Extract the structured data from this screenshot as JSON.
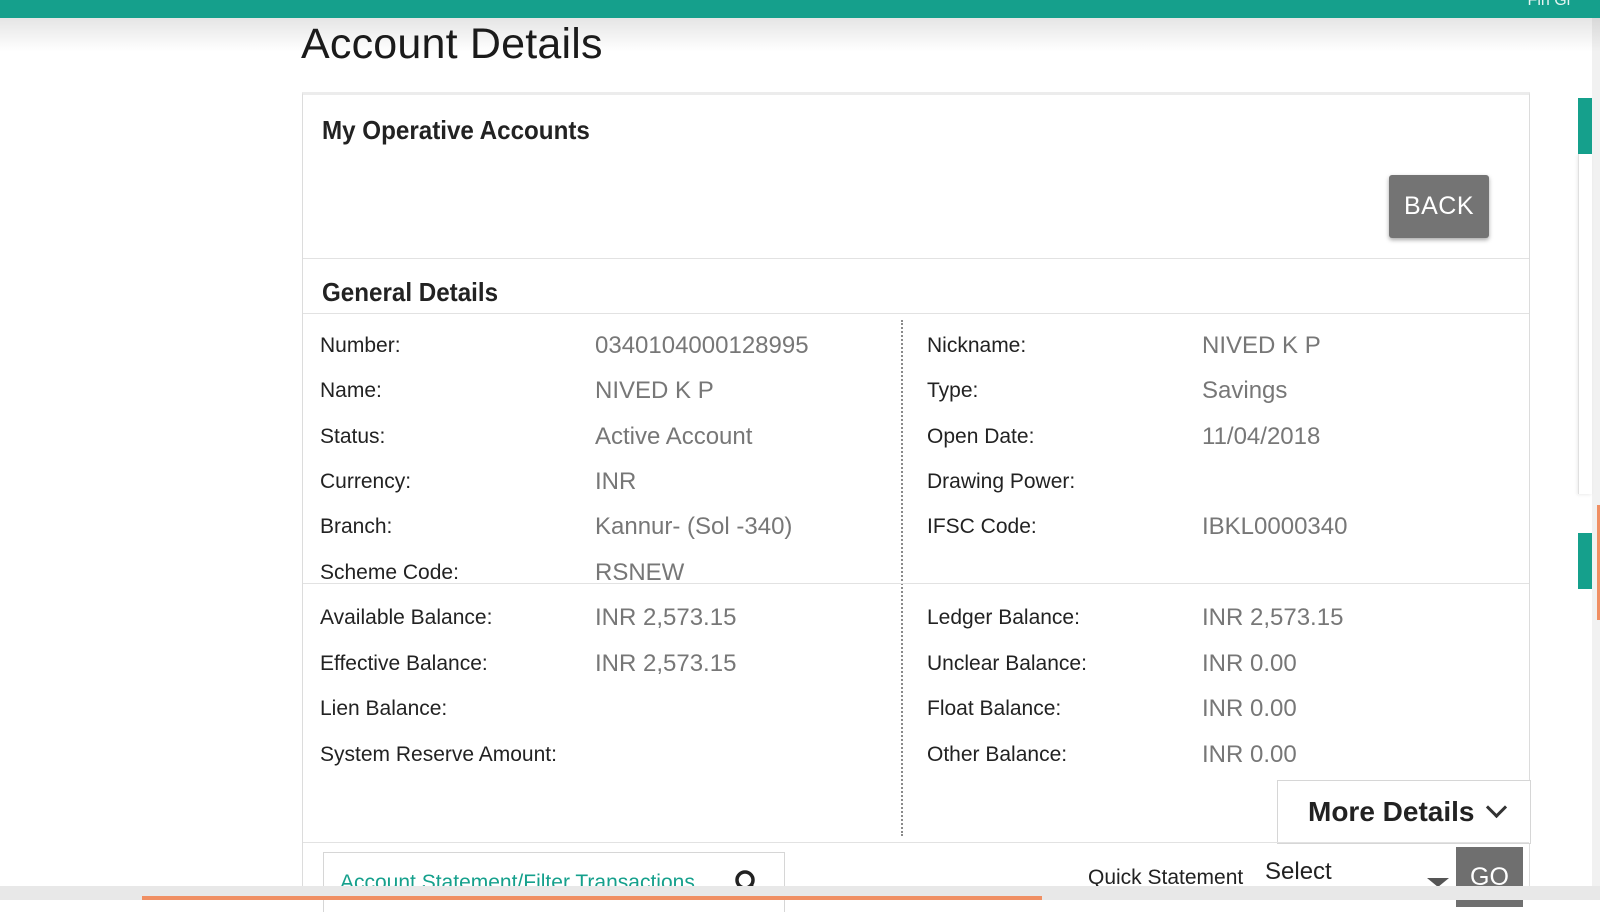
{
  "page": {
    "title": "Account Details",
    "topbar_text": "Fin Gr"
  },
  "operative": {
    "title": "My Operative Accounts",
    "back_label": "BACK"
  },
  "general": {
    "title": "General Details",
    "left_top": [
      {
        "label": "Number:",
        "value": "0340104000128995"
      },
      {
        "label": "Name:",
        "value": "NIVED K P"
      },
      {
        "label": "Status:",
        "value": "Active Account"
      },
      {
        "label": "Currency:",
        "value": "INR"
      },
      {
        "label": "Branch:",
        "value": "Kannur- (Sol -340)"
      },
      {
        "label": "Scheme Code:",
        "value": "RSNEW"
      }
    ],
    "right_top": [
      {
        "label": "Nickname:",
        "value": "NIVED K P"
      },
      {
        "label": "Type:",
        "value": "Savings"
      },
      {
        "label": "Open Date:",
        "value": "11/04/2018"
      },
      {
        "label": "Drawing Power:",
        "value": ""
      },
      {
        "label": "IFSC Code:",
        "value": "IBKL0000340"
      }
    ],
    "left_bottom": [
      {
        "label": "Available Balance:",
        "value": "INR 2,573.15"
      },
      {
        "label": "Effective Balance:",
        "value": "INR 2,573.15"
      },
      {
        "label": "Lien Balance:",
        "value": ""
      },
      {
        "label": "System Reserve Amount:",
        "value": ""
      }
    ],
    "right_bottom": [
      {
        "label": "Ledger Balance:",
        "value": "INR 2,573.15"
      },
      {
        "label": "Unclear Balance:",
        "value": "INR 0.00"
      },
      {
        "label": "Float Balance:",
        "value": "INR 0.00"
      },
      {
        "label": "Other Balance:",
        "value": "INR 0.00"
      }
    ],
    "more_details_label": "More Details"
  },
  "statement": {
    "link_label": "Account Statement/Filter Transactions",
    "quick_label": "Quick Statement",
    "select_value": "Select",
    "go_label": "GO"
  },
  "colors": {
    "brand": "#15a08c",
    "accent": "#f08f63",
    "button_gray": "#747474"
  }
}
